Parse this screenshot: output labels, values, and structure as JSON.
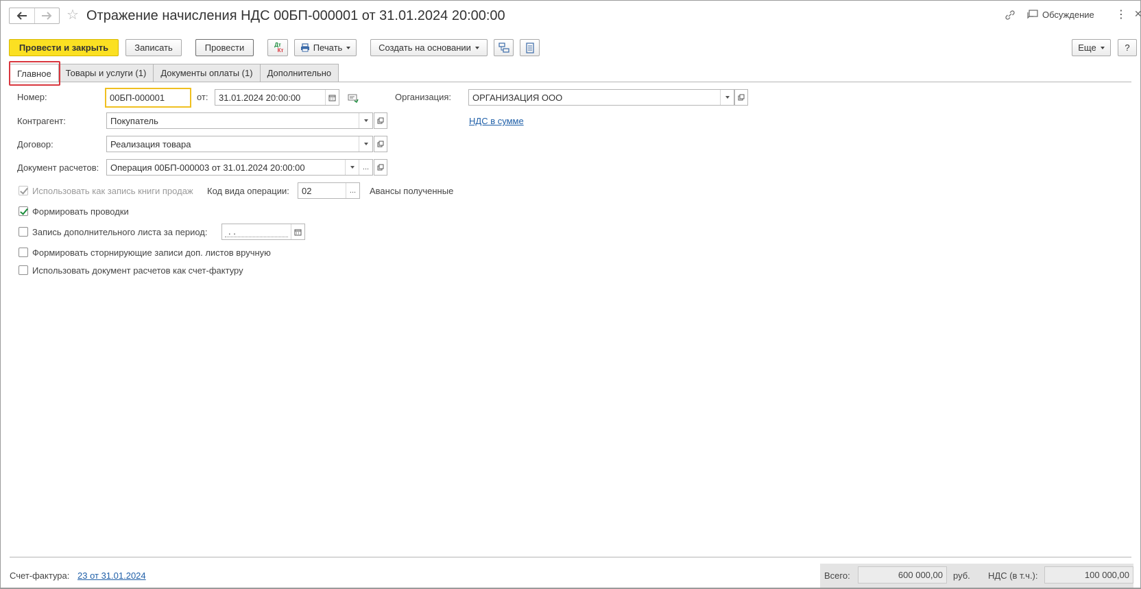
{
  "window": {
    "title": "Отражение начисления НДС 00БП-000001 от 31.01.2024 20:00:00",
    "discussion_label": "Обсуждение"
  },
  "toolbar": {
    "post_close_label": "Провести и закрыть",
    "save_label": "Записать",
    "post_label": "Провести",
    "dt_label": "Дт",
    "kt_label": "Кт",
    "print_label": "Печать",
    "create_based_label": "Создать на основании",
    "more_label": "Еще",
    "help_label": "?"
  },
  "tabs": [
    {
      "label": "Главное",
      "active": true
    },
    {
      "label": "Товары и услуги (1)",
      "active": false
    },
    {
      "label": "Документы оплаты (1)",
      "active": false
    },
    {
      "label": "Дополнительно",
      "active": false
    }
  ],
  "form": {
    "number_label": "Номер:",
    "number_value": "00БП-000001",
    "date_label": "от:",
    "date_value": "31.01.2024 20:00:00",
    "organization_label": "Организация:",
    "organization_value": "ОРГАНИЗАЦИЯ ООО",
    "counterparty_label": "Контрагент:",
    "counterparty_value": "Покупатель",
    "vat_link": "НДС в сумме",
    "contract_label": "Договор:",
    "contract_value": "Реализация товара",
    "settlement_doc_label": "Документ расчетов:",
    "settlement_doc_value": "Операция 00БП-000003 от 31.01.2024 20:00:00",
    "use_as_sales_book_label": "Использовать как запись книги продаж",
    "use_as_sales_book_checked": true,
    "op_code_label": "Код вида операции:",
    "op_code_value": "02",
    "op_code_desc": "Авансы полученные",
    "make_entries_label": "Формировать проводки",
    "make_entries_checked": true,
    "additional_sheet_label": "Запись дополнительного листа за период:",
    "additional_sheet_checked": false,
    "additional_sheet_value": " .  .",
    "storno_label": "Формировать сторнирующие записи доп. листов вручную",
    "storno_checked": false,
    "use_settlement_as_invoice_label": "Использовать документ расчетов как счет-фактуру",
    "use_settlement_as_invoice_checked": false
  },
  "footer": {
    "invoice_label": "Счет-фактура:",
    "invoice_link": "23 от 31.01.2024",
    "total_label": "Всего:",
    "total_value": "600 000,00",
    "currency": "руб.",
    "vat_label": "НДС (в т.ч.):",
    "vat_value": "100 000,00"
  },
  "colors": {
    "primary_button": "#fbe022",
    "link": "#1f5fa8",
    "highlight": "#d9363e",
    "focus_border": "#f0c020"
  }
}
